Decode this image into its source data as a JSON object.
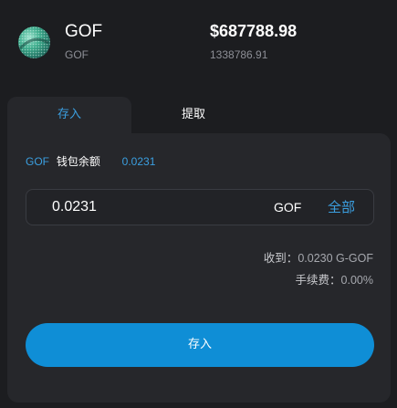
{
  "token": {
    "name": "GOF",
    "subtitle": "GOF",
    "usd_value": "$687788.98",
    "amount": "1338786.91",
    "icon": "token-logo-icon"
  },
  "tabs": [
    {
      "label": "存入",
      "active": true
    },
    {
      "label": "提取",
      "active": false
    }
  ],
  "balance": {
    "symbol": "GOF",
    "label": "钱包余额",
    "value": "0.0231"
  },
  "amount_field": {
    "value": "0.0231",
    "unit": "GOF",
    "max_label": "全部"
  },
  "info": {
    "receive_label": "收到：",
    "receive_value": "0.0230 G-GOF",
    "fee_label": "手续费：",
    "fee_value": "0.00%"
  },
  "submit_label": "存入",
  "colors": {
    "accent": "#3b9fe0",
    "button": "#0f8ed6",
    "background": "#1c1d20",
    "panel": "#26272b"
  }
}
